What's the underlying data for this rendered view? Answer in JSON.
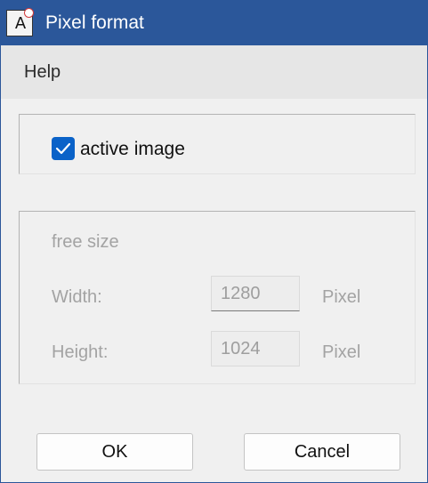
{
  "window": {
    "title": "Pixel format",
    "icon": "app-icon",
    "icon_letter": "A",
    "accent_color": "#2b579a"
  },
  "menu": {
    "items": [
      {
        "label": "Help"
      }
    ]
  },
  "active_group": {
    "checkbox_checked": true,
    "checkbox_label": "active image",
    "checkbox_color": "#0a62c8"
  },
  "size_group": {
    "title": "free size",
    "width": {
      "label": "Width:",
      "value": "1280",
      "unit": "Pixel"
    },
    "height": {
      "label": "Height:",
      "value": "1024",
      "unit": "Pixel"
    }
  },
  "buttons": {
    "ok_label": "OK",
    "cancel_label": "Cancel"
  }
}
